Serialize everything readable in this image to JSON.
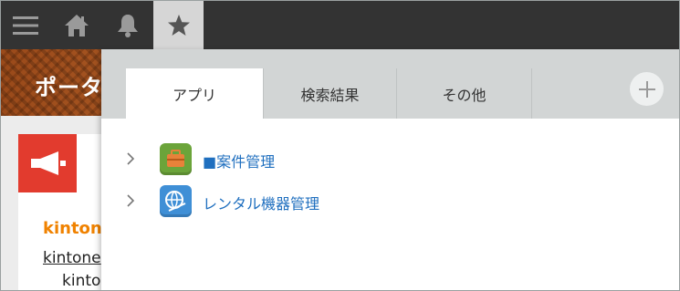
{
  "topbar": {
    "icons": [
      "menu-icon",
      "home-icon",
      "bell-icon",
      "star-icon"
    ]
  },
  "portal": {
    "title": "ポータ",
    "card": {
      "title": "kinton",
      "link": "kintone",
      "subtext": "kinto"
    }
  },
  "popup": {
    "tabs": [
      {
        "label": "アプリ",
        "active": true
      },
      {
        "label": "検索結果",
        "active": false
      },
      {
        "label": "その他",
        "active": false
      }
    ],
    "apps": [
      {
        "label": "■案件管理",
        "icon": "briefcase-icon"
      },
      {
        "label": "レンタル機器管理",
        "icon": "globe-icon"
      }
    ]
  },
  "colors": {
    "topbar": "#333333",
    "tab_bar": "#d2d5d5",
    "link_blue": "#1f6fbf",
    "accent_orange": "#f08200",
    "announce_red": "#e23b2e"
  }
}
